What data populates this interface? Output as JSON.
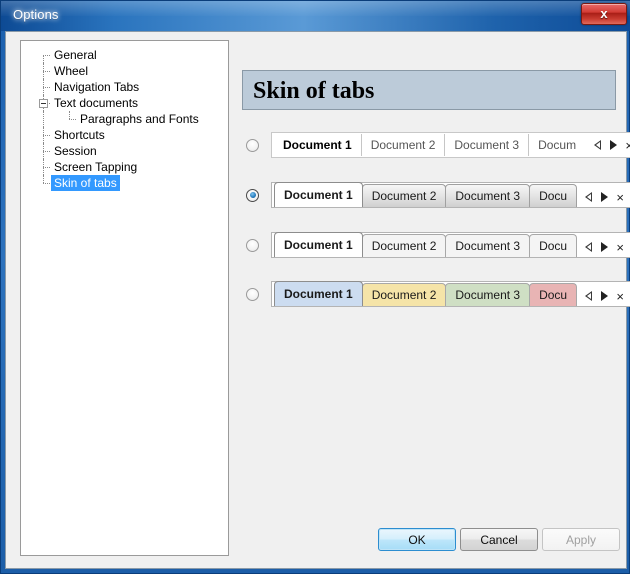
{
  "window": {
    "title": "Options",
    "close_label": "x"
  },
  "tree": {
    "items": [
      {
        "label": "General",
        "level": 1,
        "selected": false,
        "expander": false
      },
      {
        "label": "Wheel",
        "level": 1,
        "selected": false,
        "expander": false
      },
      {
        "label": "Navigation Tabs",
        "level": 1,
        "selected": false,
        "expander": false
      },
      {
        "label": "Text documents",
        "level": 1,
        "selected": false,
        "expander": true
      },
      {
        "label": "Paragraphs and Fonts",
        "level": 2,
        "selected": false,
        "expander": false
      },
      {
        "label": "Shortcuts",
        "level": 1,
        "selected": false,
        "expander": false
      },
      {
        "label": "Session",
        "level": 1,
        "selected": false,
        "expander": false
      },
      {
        "label": "Screen Tapping",
        "level": 1,
        "selected": false,
        "expander": false
      },
      {
        "label": "Skin of tabs",
        "level": 1,
        "selected": true,
        "expander": false
      }
    ]
  },
  "panel": {
    "header": "Skin of tabs"
  },
  "skins": [
    {
      "style": "a",
      "selected": false,
      "tabs": [
        {
          "label": "Document 1",
          "active": true,
          "color": ""
        },
        {
          "label": "Document 2",
          "active": false,
          "color": ""
        },
        {
          "label": "Document 3",
          "active": false,
          "color": ""
        },
        {
          "label": "Docum",
          "active": false,
          "color": ""
        }
      ]
    },
    {
      "style": "b",
      "selected": true,
      "tabs": [
        {
          "label": "Document 1",
          "active": true,
          "color": ""
        },
        {
          "label": "Document 2",
          "active": false,
          "color": ""
        },
        {
          "label": "Document 3",
          "active": false,
          "color": ""
        },
        {
          "label": "Docu",
          "active": false,
          "color": ""
        }
      ]
    },
    {
      "style": "c",
      "selected": false,
      "tabs": [
        {
          "label": "Document 1",
          "active": true,
          "color": ""
        },
        {
          "label": "Document 2",
          "active": false,
          "color": ""
        },
        {
          "label": "Document 3",
          "active": false,
          "color": ""
        },
        {
          "label": "Docu",
          "active": false,
          "color": ""
        }
      ]
    },
    {
      "style": "d",
      "selected": false,
      "tabs": [
        {
          "label": "Document 1",
          "active": true,
          "color": "#ccdcf0"
        },
        {
          "label": "Document 2",
          "active": false,
          "color": "#f5e4a8"
        },
        {
          "label": "Document 3",
          "active": false,
          "color": "#cfdfc4"
        },
        {
          "label": "Docu",
          "active": false,
          "color": "#e8b4b4"
        }
      ]
    }
  ],
  "nav": {
    "prev_icon": "triangle-left-icon",
    "next_icon": "triangle-right-icon",
    "close_icon": "close-tab-icon",
    "close_glyph": "×"
  },
  "buttons": {
    "ok": "OK",
    "cancel": "Cancel",
    "apply": "Apply"
  },
  "colors": {
    "selection": "#3399ff",
    "header_bg": "#bccbd9",
    "tab_blue": "#ccdcf0",
    "tab_yellow": "#f5e4a8",
    "tab_green": "#cfdfc4",
    "tab_red": "#e8b4b4"
  }
}
